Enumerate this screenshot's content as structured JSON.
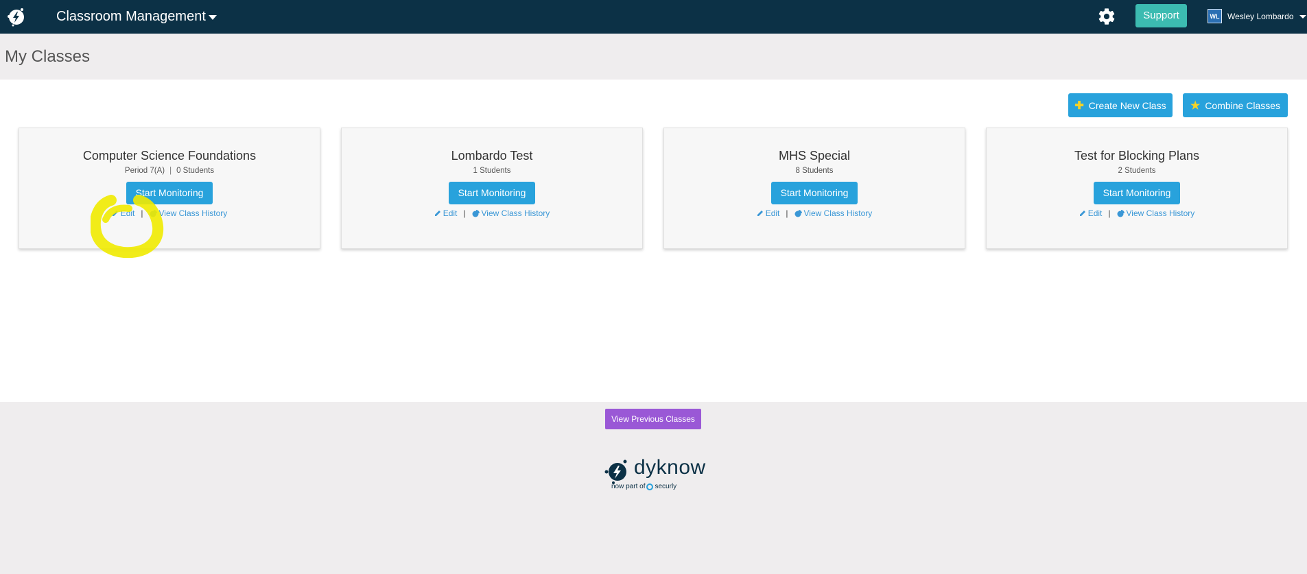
{
  "header": {
    "app_menu_label": "Classroom Management",
    "support_label": "Support",
    "user_initials": "WL",
    "user_name": "Wesley Lombardo",
    "colors": {
      "bar": "#0c3146",
      "support": "#3cbbb1"
    }
  },
  "page_title": "My Classes",
  "actions": {
    "create_label": "Create New Class",
    "combine_label": "Combine Classes"
  },
  "classes": [
    {
      "title": "Computer Science Foundations",
      "period": "Period 7(A)",
      "students": "0 Students",
      "start_label": "Start Monitoring",
      "edit_label": "Edit",
      "history_label": "View Class History"
    },
    {
      "title": "Lombardo Test",
      "period": "",
      "students": "1 Students",
      "start_label": "Start Monitoring",
      "edit_label": "Edit",
      "history_label": "View Class History"
    },
    {
      "title": "MHS Special",
      "period": "",
      "students": "8 Students",
      "start_label": "Start Monitoring",
      "edit_label": "Edit",
      "history_label": "View Class History"
    },
    {
      "title": "Test for Blocking Plans",
      "period": "",
      "students": "2 Students",
      "start_label": "Start Monitoring",
      "edit_label": "Edit",
      "history_label": "View Class History"
    }
  ],
  "footer": {
    "previous_label": "View Previous Classes",
    "brand_name": "dyknow",
    "brand_sub_prefix": "now part of",
    "brand_sub_partner": "securly"
  },
  "icons": [
    "logo-icon",
    "chevron-down-icon",
    "gear-icon",
    "plus-icon",
    "star-icon",
    "pencil-icon",
    "pie-chart-icon"
  ],
  "accent_colors": {
    "primary_button": "#28a2dc",
    "previous_button": "#9a58d6",
    "link": "#3a97d6",
    "annotation": "#f0ea00"
  }
}
